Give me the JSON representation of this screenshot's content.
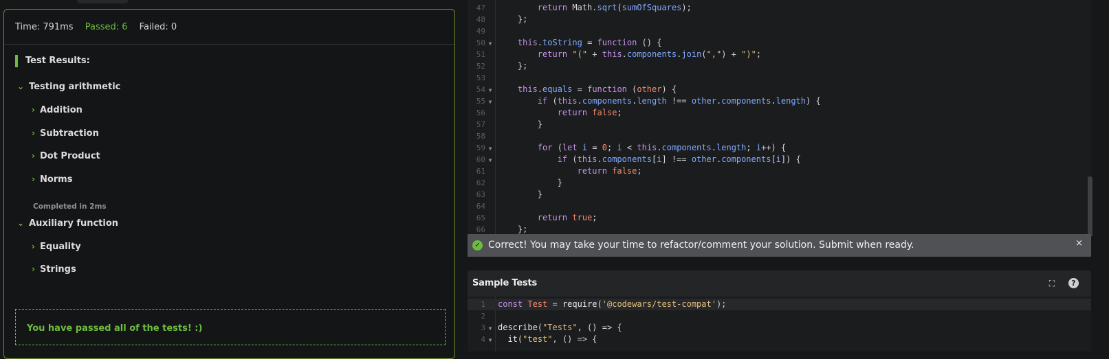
{
  "results": {
    "time_label": "Time: 791ms",
    "passed_label": "Passed: 6",
    "failed_label": "Failed: 0",
    "heading": "Test Results:",
    "groups": [
      {
        "label": "Testing arithmetic",
        "items": [
          "Addition",
          "Subtraction",
          "Dot Product",
          "Norms"
        ],
        "completed": "Completed in 2ms"
      },
      {
        "label": "Auxiliary function",
        "items": [
          "Equality",
          "Strings"
        ]
      }
    ],
    "passed_message": "You have passed all of the tests! :)"
  },
  "editor": {
    "line_numbers": [
      "47",
      "48",
      "49",
      "50",
      "51",
      "52",
      "53",
      "54",
      "55",
      "56",
      "57",
      "58",
      "59",
      "60",
      "61",
      "62",
      "63",
      "64",
      "65",
      "66"
    ]
  },
  "banner": {
    "message": "Correct! You may take your time to refactor/comment your solution. Submit when ready.",
    "close": "×"
  },
  "sample_tests": {
    "title": "Sample Tests",
    "line_numbers": [
      "1",
      "2",
      "3",
      "4"
    ]
  },
  "colors": {
    "accent_green": "#6dbb3f",
    "banner_bg": "#4f5154"
  }
}
